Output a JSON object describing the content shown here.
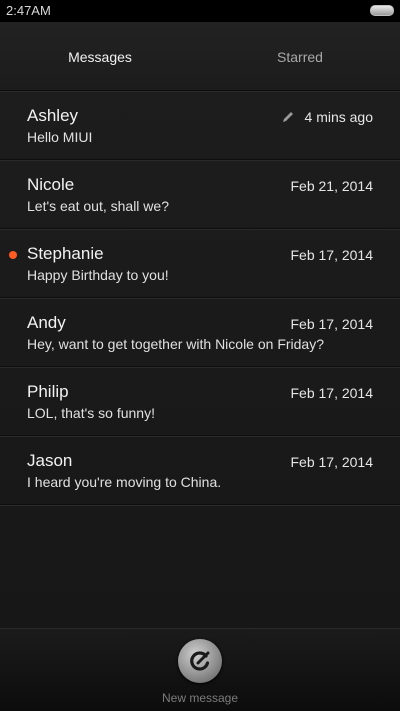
{
  "status_bar": {
    "time": "2:47AM"
  },
  "tabs": [
    {
      "label": "Messages",
      "active": true
    },
    {
      "label": "Starred",
      "active": false
    }
  ],
  "messages": [
    {
      "name": "Ashley",
      "preview": "Hello MIUI",
      "date": "4 mins ago",
      "draft": true,
      "unread": false
    },
    {
      "name": "Nicole",
      "preview": "Let's eat out, shall we?",
      "date": "Feb 21, 2014",
      "draft": false,
      "unread": false
    },
    {
      "name": "Stephanie",
      "preview": "Happy Birthday to you!",
      "date": "Feb 17, 2014",
      "draft": false,
      "unread": true
    },
    {
      "name": "Andy",
      "preview": "Hey, want to get together with Nicole on Friday?",
      "date": "Feb 17, 2014",
      "draft": false,
      "unread": false
    },
    {
      "name": "Philip",
      "preview": "LOL, that's so funny!",
      "date": "Feb 17, 2014",
      "draft": false,
      "unread": false
    },
    {
      "name": "Jason",
      "preview": "I heard you're moving to China.",
      "date": "Feb 17, 2014",
      "draft": false,
      "unread": false
    }
  ],
  "bottom_bar": {
    "compose_label": "New message",
    "compose_icon": "compose-icon"
  },
  "colors": {
    "unread_dot": "#ff5a1f"
  }
}
